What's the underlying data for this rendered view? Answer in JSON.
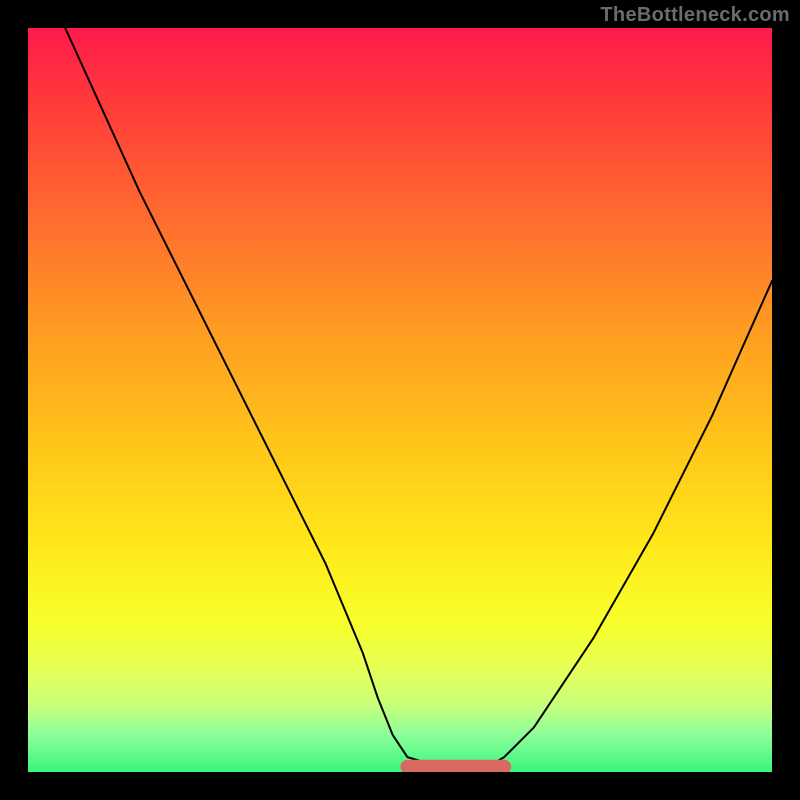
{
  "attribution": "TheBottleneck.com",
  "chart_data": {
    "type": "line",
    "title": "",
    "xlabel": "",
    "ylabel": "",
    "xlim": [
      0,
      100
    ],
    "ylim": [
      0,
      100
    ],
    "grid": false,
    "legend": false,
    "series": [
      {
        "name": "curve",
        "x": [
          5,
          10,
          15,
          20,
          25,
          30,
          35,
          40,
          45,
          47,
          49,
          51,
          55,
          58,
          60,
          62,
          64,
          68,
          72,
          76,
          80,
          84,
          88,
          92,
          96,
          100
        ],
        "values": [
          100,
          89,
          78,
          68,
          58,
          48,
          38,
          28,
          16,
          10,
          5,
          2,
          0.8,
          0.6,
          0.6,
          0.8,
          2,
          6,
          12,
          18,
          25,
          32,
          40,
          48,
          57,
          66
        ]
      }
    ],
    "flat_segment": {
      "x_start": 51,
      "x_end": 64,
      "y": 0.7,
      "note": "salmon rounded band at curve trough"
    },
    "background_gradient": {
      "top": "#ff1a4b",
      "bottom": "#39f57c",
      "stops": [
        "#ff1a4b",
        "#ff3a3a",
        "#ff6a2f",
        "#ff9a22",
        "#ffc31a",
        "#ffe91a",
        "#f7ff2a",
        "#e8ff55",
        "#c8ff7a",
        "#8cff9a",
        "#39f57c"
      ]
    }
  }
}
